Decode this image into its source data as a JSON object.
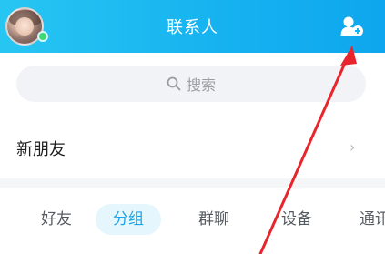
{
  "header": {
    "title": "联系人",
    "avatar_icon": "user-avatar",
    "status_color": "#3ed96f",
    "add_friend_icon": "add-friend-icon",
    "background_color": "#16b3f0"
  },
  "search": {
    "placeholder": "搜索",
    "icon": "search-icon"
  },
  "new_friends": {
    "label": "新朋友",
    "chevron": "›"
  },
  "tabs": [
    {
      "label": "好友",
      "active": false
    },
    {
      "label": "分组",
      "active": true
    },
    {
      "label": "群聊",
      "active": false
    },
    {
      "label": "设备",
      "active": false
    },
    {
      "label": "通讯",
      "active": false
    }
  ],
  "annotation": {
    "type": "arrow",
    "color": "#e8252c",
    "target": "add-friend-button"
  }
}
